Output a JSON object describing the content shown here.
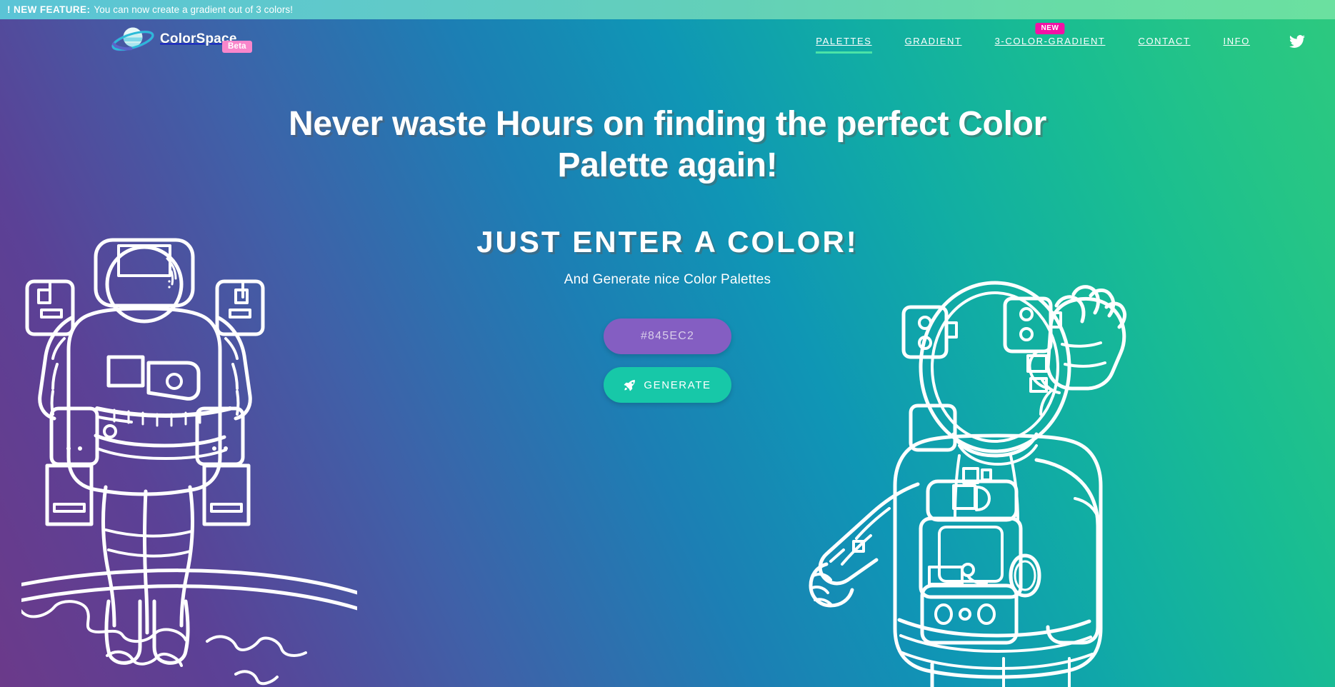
{
  "announcement": {
    "badge_label": "! NEW FEATURE:",
    "text": "You can now create a gradient out of 3 colors!"
  },
  "header": {
    "brand_name": "ColorSpace",
    "brand_logo_icon": "planet-icon",
    "beta_badge": "Beta",
    "nav": [
      {
        "label": "PALETTES",
        "active": true,
        "badge": ""
      },
      {
        "label": "GRADIENT",
        "active": false,
        "badge": ""
      },
      {
        "label": "3-COLOR-GRADIENT",
        "active": false,
        "badge": "NEW"
      },
      {
        "label": "CONTACT",
        "active": false,
        "badge": ""
      },
      {
        "label": "INFO",
        "active": false,
        "badge": ""
      }
    ],
    "social_icon": "twitter-icon"
  },
  "hero": {
    "headline": "Never waste Hours on finding the perfect Color Palette again!",
    "subheadline": "JUST ENTER A COLOR!",
    "tagline": "And Generate nice Color Palettes"
  },
  "form": {
    "color_value": "#845EC2",
    "color_placeholder": "#845EC2",
    "generate_label": "GENERATE",
    "generate_icon": "rocket-icon"
  },
  "colors": {
    "gradient_start": "#6B3A8A",
    "gradient_mid": "#0F96B5",
    "gradient_end": "#2DC97F",
    "input_bg": "#845EC2",
    "button_bg": "#17C8A8",
    "beta_badge_bg": "#F986CB",
    "new_badge_bg": "#F410A5",
    "active_underline": "#4BE3A7",
    "announce_start": "#5BC4D6",
    "announce_end": "#6BE0A0"
  },
  "illustrations": {
    "left": "astronaut-on-planet-illustration",
    "right": "astronaut-waving-illustration"
  }
}
